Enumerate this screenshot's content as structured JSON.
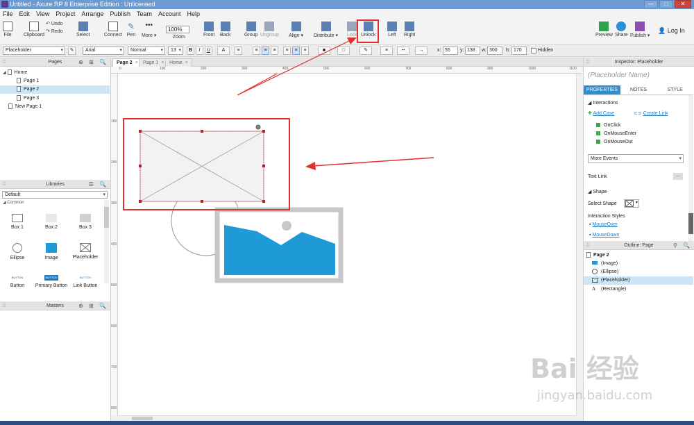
{
  "window": {
    "title": "Untitled - Axure RP 8 Enterprise Edition : Unlicensed",
    "buttons": [
      "—",
      "□",
      "✕"
    ]
  },
  "menu": [
    "File",
    "Edit",
    "View",
    "Project",
    "Arrange",
    "Publish",
    "Team",
    "Account",
    "Help"
  ],
  "toolbar": {
    "file": "File",
    "clipboard": "Clipboard",
    "undo": "Undo",
    "redo": "Redo",
    "select": "Select",
    "connect": "Connect",
    "pen": "Pen",
    "more": "More ▾",
    "zoom_value": "100%",
    "zoom": "Zoom",
    "front": "Front",
    "back": "Back",
    "group": "Group",
    "ungroup": "Ungroup",
    "align": "Align ▾",
    "distribute": "Distribute ▾",
    "lock": "Lock",
    "unlock": "Unlock",
    "left": "Left",
    "right": "Right",
    "preview": "Preview",
    "share": "Share",
    "publish": "Publish ▾",
    "login": "Log In"
  },
  "format": {
    "widget_style": "Placeholder",
    "font": "Arial",
    "weight": "Normal",
    "size": "13",
    "bold": "B",
    "italic": "I",
    "underline": "U",
    "x_label": "x:",
    "x": "55",
    "y_label": "y:",
    "y": "138",
    "w_label": "w:",
    "w": "300",
    "h_label": "h:",
    "h": "170",
    "hidden": "Hidden"
  },
  "pages_panel": {
    "title": "Pages",
    "items": [
      {
        "label": "Home",
        "level": 0,
        "expanded": true
      },
      {
        "label": "Page 1",
        "level": 1
      },
      {
        "label": "Page 2",
        "level": 1,
        "selected": true
      },
      {
        "label": "Page 3",
        "level": 1
      },
      {
        "label": "New Page 1",
        "level": 0
      }
    ]
  },
  "libraries_panel": {
    "title": "Libraries",
    "library": "Default",
    "group": "Common",
    "items": [
      "Box 1",
      "Box 2",
      "Box 3",
      "Ellipse",
      "Image",
      "Placeholder",
      "Button",
      "Primary Button",
      "Link Button"
    ],
    "button_thumb": "BUTTON"
  },
  "masters_panel": {
    "title": "Masters"
  },
  "tabs": [
    "Page 2",
    "Page 1",
    "Home"
  ],
  "ruler": {
    "h": [
      "0",
      "100",
      "200",
      "300",
      "400",
      "500",
      "600",
      "700",
      "800",
      "900",
      "1000",
      "1100"
    ],
    "v": [
      "100",
      "200",
      "300",
      "400",
      "500",
      "600",
      "700",
      "800"
    ]
  },
  "inspector": {
    "title": "Inspector: Placeholder",
    "name_placeholder": "(Placeholder Name)",
    "tabs": [
      "PROPERTIES",
      "NOTES",
      "STYLE"
    ],
    "interactions": "Interactions",
    "add_case": "Add Case",
    "create_link": "Create Link",
    "events": [
      "OnClick",
      "OnMouseEnter",
      "OnMouseOut"
    ],
    "more_events": "More Events",
    "text_link": "Text Link",
    "shape": "Shape",
    "select_shape": "Select Shape",
    "interaction_styles": "Interaction Styles",
    "mouse_over": "MouseOver",
    "mouse_down": "MouseDown"
  },
  "outline": {
    "title": "Outline: Page",
    "page": "Page 2",
    "items": [
      "(Image)",
      "(Ellipse)",
      "(Placeholder)",
      "(Rectangle)"
    ]
  },
  "watermark": {
    "main": "Bai 经验",
    "sub": "jingyan.baidu.com"
  },
  "colors": {
    "accent": "#2a8fd6",
    "highlight": "#e03030",
    "image_blue": "#1e9bd7"
  }
}
